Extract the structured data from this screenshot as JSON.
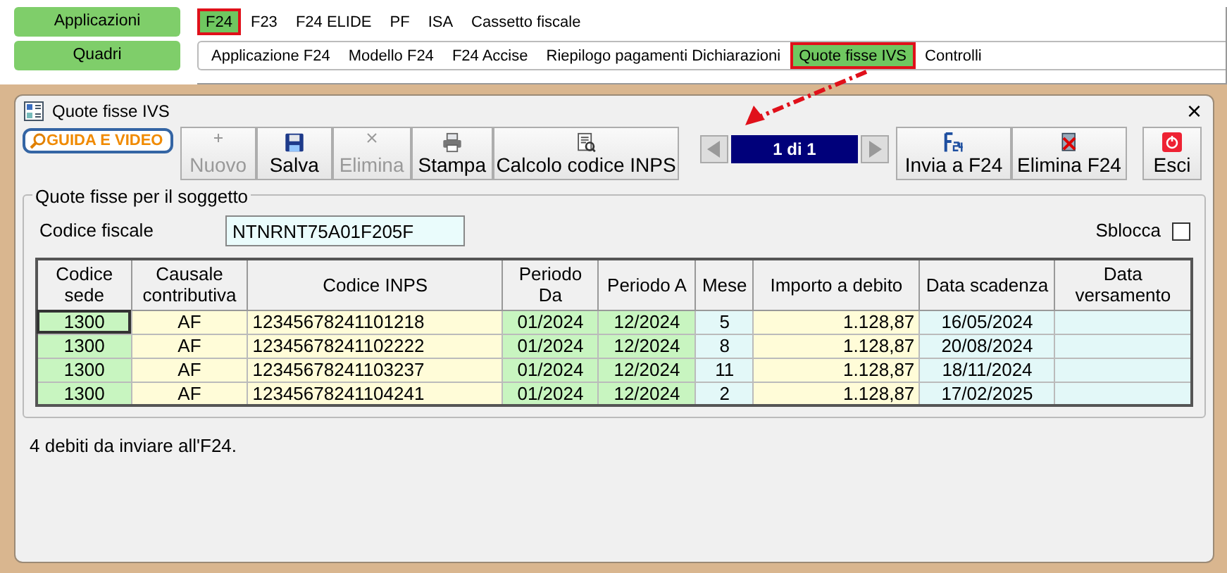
{
  "side_buttons": [
    "Applicazioni",
    "Quadri"
  ],
  "menu_top": [
    {
      "label": "F24",
      "selected": true
    },
    {
      "label": "F23",
      "selected": false
    },
    {
      "label": "F24 ELIDE",
      "selected": false
    },
    {
      "label": "PF",
      "selected": false
    },
    {
      "label": "ISA",
      "selected": false
    },
    {
      "label": "Cassetto fiscale",
      "selected": false
    }
  ],
  "menu_sub": [
    {
      "label": "Applicazione F24",
      "selected": false
    },
    {
      "label": "Modello F24",
      "selected": false
    },
    {
      "label": "F24 Accise",
      "selected": false
    },
    {
      "label": "Riepilogo pagamenti Dichiarazioni",
      "selected": false
    },
    {
      "label": "Quote fisse IVS",
      "selected": true
    },
    {
      "label": "Controlli",
      "selected": false
    }
  ],
  "window": {
    "title": "Quote fisse IVS",
    "close": "×"
  },
  "guide_button": "GUIDA E VIDEO",
  "toolbar": [
    {
      "label": "Nuovo",
      "kind": "plus",
      "disabled": true
    },
    {
      "label": "Salva",
      "kind": "save",
      "disabled": false
    },
    {
      "label": "Elimina",
      "kind": "cross",
      "disabled": true
    },
    {
      "label": "Stampa",
      "kind": "print",
      "disabled": false
    },
    {
      "label": "Calcolo codice INPS",
      "kind": "calc",
      "disabled": false
    }
  ],
  "pager": "1 di 1",
  "toolbar_right": [
    {
      "label": "Invia a F24",
      "kind": "f24"
    },
    {
      "label": "Elimina F24",
      "kind": "delf24"
    }
  ],
  "exit_button": "Esci",
  "group": {
    "title": "Quote fisse per il soggetto",
    "codice_label": "Codice fiscale",
    "codice_value": "NTNRNT75A01F205F",
    "unlock_label": "Sblocca",
    "unlock_checked": false
  },
  "table": {
    "columns": [
      {
        "label": "Codice sede",
        "color": "#c8f5c0"
      },
      {
        "label": "Causale contributiva",
        "color": "#fffcd8"
      },
      {
        "label": "Codice INPS",
        "color": "#fffcd8"
      },
      {
        "label": "Periodo Da",
        "color": "#c8f5c0"
      },
      {
        "label": "Periodo A",
        "color": "#c8f5c0"
      },
      {
        "label": "Mese",
        "color": "#e3f8f8"
      },
      {
        "label": "Importo a debito",
        "color": "#fffcd8"
      },
      {
        "label": "Data scadenza",
        "color": "#e3f8f8"
      },
      {
        "label": "Data versamento",
        "color": "#e3f8f8"
      }
    ],
    "rows": [
      {
        "selected": true,
        "cells": [
          "1300",
          "AF",
          "12345678241101218",
          "01/2024",
          "12/2024",
          "5",
          "1.128,87",
          "16/05/2024",
          ""
        ]
      },
      {
        "selected": false,
        "cells": [
          "1300",
          "AF",
          "12345678241102222",
          "01/2024",
          "12/2024",
          "8",
          "1.128,87",
          "20/08/2024",
          ""
        ]
      },
      {
        "selected": false,
        "cells": [
          "1300",
          "AF",
          "12345678241103237",
          "01/2024",
          "12/2024",
          "11",
          "1.128,87",
          "18/11/2024",
          ""
        ]
      },
      {
        "selected": false,
        "cells": [
          "1300",
          "AF",
          "12345678241104241",
          "01/2024",
          "12/2024",
          "2",
          "1.128,87",
          "17/02/2025",
          ""
        ]
      }
    ]
  },
  "status": "4 debiti da inviare all'F24."
}
